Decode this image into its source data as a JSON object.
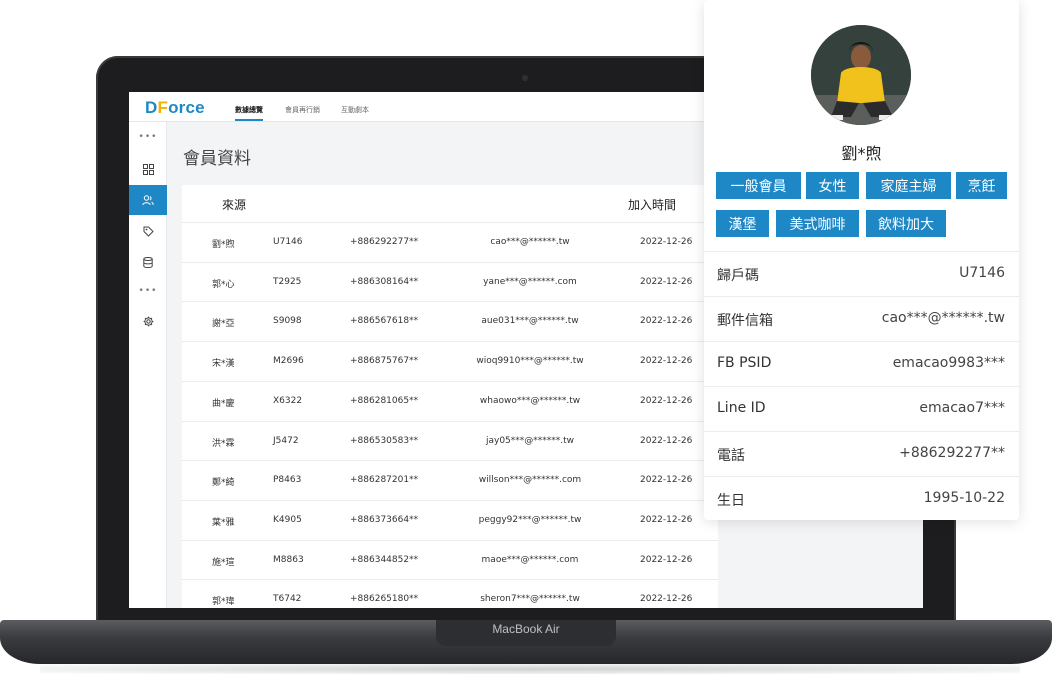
{
  "app": {
    "logo_d": "D",
    "logo_f": "F",
    "logo_rest": "orce",
    "nav_tabs": [
      "數據總覽",
      "會員再行銷",
      "互動劇本"
    ],
    "page_title": "會員資料"
  },
  "device": {
    "label": "MacBook Air"
  },
  "sidebar": {
    "items": [
      {
        "icon": "more-icon"
      },
      {
        "icon": "dashboard-icon"
      },
      {
        "icon": "users-icon"
      },
      {
        "icon": "tag-icon"
      },
      {
        "icon": "database-icon"
      },
      {
        "icon": "more-icon"
      },
      {
        "icon": "gear-icon"
      }
    ]
  },
  "table": {
    "headers": [
      "來源",
      "加入時間"
    ],
    "rows": [
      {
        "name": "劉*煦",
        "id": "U7146",
        "phone": "+886292277**",
        "email": "cao***@******.tw",
        "date": "2022-12-26"
      },
      {
        "name": "郭*心",
        "id": "T2925",
        "phone": "+886308164**",
        "email": "yane***@******.com",
        "date": "2022-12-26"
      },
      {
        "name": "謝*亞",
        "id": "S9098",
        "phone": "+886567618**",
        "email": "aue031***@******.tw",
        "date": "2022-12-26"
      },
      {
        "name": "宋*漢",
        "id": "M2696",
        "phone": "+886875767**",
        "email": "wioq9910***@******.tw",
        "date": "2022-12-26"
      },
      {
        "name": "曲*慶",
        "id": "X6322",
        "phone": "+886281065**",
        "email": "whaowo***@******.tw",
        "date": "2022-12-26"
      },
      {
        "name": "洪*霖",
        "id": "J5472",
        "phone": "+886530583**",
        "email": "jay05***@******.tw",
        "date": "2022-12-26"
      },
      {
        "name": "鄭*綺",
        "id": "P8463",
        "phone": "+886287201**",
        "email": "willson***@******.com",
        "date": "2022-12-26"
      },
      {
        "name": "葉*雅",
        "id": "K4905",
        "phone": "+886373664**",
        "email": "peggy92***@******.tw",
        "date": "2022-12-26"
      },
      {
        "name": "施*瑄",
        "id": "M8863",
        "phone": "+886344852**",
        "email": "maoe***@******.com",
        "date": "2022-12-26"
      },
      {
        "name": "郭*瑋",
        "id": "T6742",
        "phone": "+886265180**",
        "email": "sheron7***@******.tw",
        "date": "2022-12-26"
      }
    ]
  },
  "profile": {
    "name": "劉*煦",
    "tags": [
      "一般會員",
      "女性",
      "家庭主婦",
      "烹飪",
      "漢堡",
      "美式咖啡",
      "飲料加大"
    ],
    "fields": [
      {
        "label": "歸戶碼",
        "value": "U7146"
      },
      {
        "label": "郵件信箱",
        "value": "cao***@******.tw"
      },
      {
        "label": "FB PSID",
        "value": "emacao9983***"
      },
      {
        "label": "Line ID",
        "value": "emacao7***"
      },
      {
        "label": "電話",
        "value": "+886292277**"
      },
      {
        "label": "生日",
        "value": "1995-10-22"
      }
    ]
  },
  "colors": {
    "accent": "#1e88c6",
    "logo_f": "#f2b200",
    "laptop": "#1d1d1f"
  }
}
